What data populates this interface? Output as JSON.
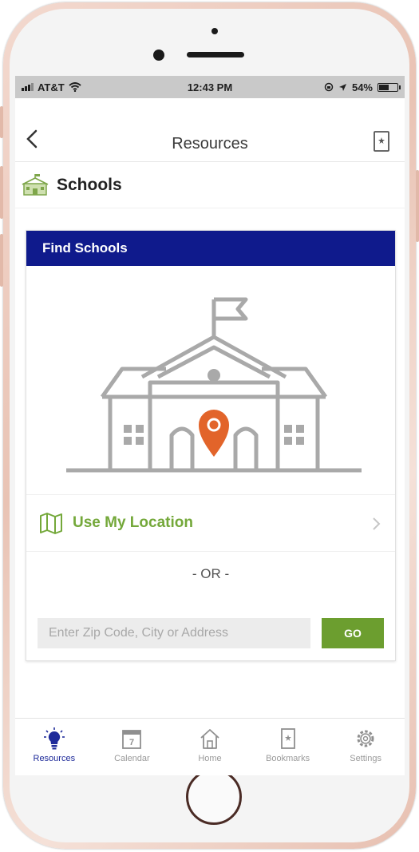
{
  "status_bar": {
    "carrier": "AT&T",
    "time": "12:43 PM",
    "battery_percent": "54%",
    "battery_level": 0.54
  },
  "nav": {
    "title": "Resources",
    "back_icon": "chevron-left-icon",
    "bookmark_icon": "bookmark-icon"
  },
  "section": {
    "title": "Schools",
    "icon": "school-building-icon"
  },
  "card": {
    "header": "Find Schools",
    "illustration_icon": "school-with-location-pin-icon",
    "use_location_label": "Use My Location",
    "or_text": "- OR -",
    "search_placeholder": "Enter Zip Code, City or Address",
    "go_label": "GO"
  },
  "tabs": [
    {
      "label": "Resources",
      "icon": "lightbulb-icon",
      "active": true
    },
    {
      "label": "Calendar",
      "icon": "calendar-icon",
      "active": false
    },
    {
      "label": "Home",
      "icon": "home-icon",
      "active": false
    },
    {
      "label": "Bookmarks",
      "icon": "bookmark-icon",
      "active": false
    },
    {
      "label": "Settings",
      "icon": "gear-icon",
      "active": false
    }
  ],
  "colors": {
    "header_blue": "#0f1a8c",
    "accent_green": "#6c9e2f",
    "pin_orange": "#e2642a",
    "active_tab": "#1f2b9a"
  }
}
